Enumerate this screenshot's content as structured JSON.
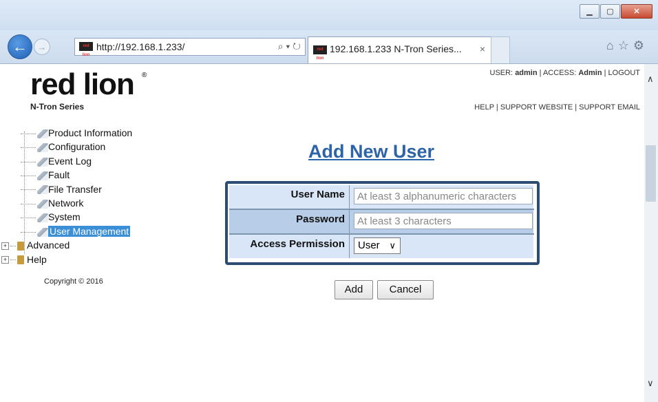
{
  "browser": {
    "address_url": "http://192.168.1.233/",
    "tab_title": "192.168.1.233 N-Tron Series...",
    "tab_close": "×",
    "search_refresh": "⌕ ▾ ↻",
    "toolbar_icons": "⌂☆⚙",
    "window_controls": {
      "minimize": "▁",
      "maximize": "▢",
      "close": "✕"
    },
    "icons": {
      "back": "←",
      "forward": "→",
      "favicon": "red lion"
    }
  },
  "header": {
    "logo_word": "red lion",
    "logo_sub": "N-Tron Series",
    "logo_reg": "®",
    "user_label": "USER:",
    "user_value": "admin",
    "sep1": "|",
    "access_label": "ACCESS:",
    "access_value": "Admin",
    "sep2": "|",
    "logout": "LOGOUT",
    "help": "HELP",
    "sep3": "|",
    "support_website": "SUPPORT WEBSITE",
    "sep4": "|",
    "support_email": "SUPPORT EMAIL"
  },
  "nav": {
    "items": [
      {
        "label": "Product Information"
      },
      {
        "label": "Configuration"
      },
      {
        "label": "Event Log"
      },
      {
        "label": "Fault"
      },
      {
        "label": "File Transfer"
      },
      {
        "label": "Network"
      },
      {
        "label": "System"
      },
      {
        "label": "User Management"
      },
      {
        "label": "Advanced"
      },
      {
        "label": "Help"
      }
    ],
    "copyright": "Copyright © 2016"
  },
  "main": {
    "title": "Add New User",
    "form": {
      "username_label": "User Name",
      "username_placeholder": "At least 3 alphanumeric characters",
      "password_label": "Password",
      "password_placeholder": "At least 3 characters",
      "access_label": "Access Permission",
      "access_value": "User"
    },
    "buttons": {
      "add": "Add",
      "cancel": "Cancel"
    }
  },
  "scrollbar": {
    "up": "∧",
    "down": "∨"
  }
}
